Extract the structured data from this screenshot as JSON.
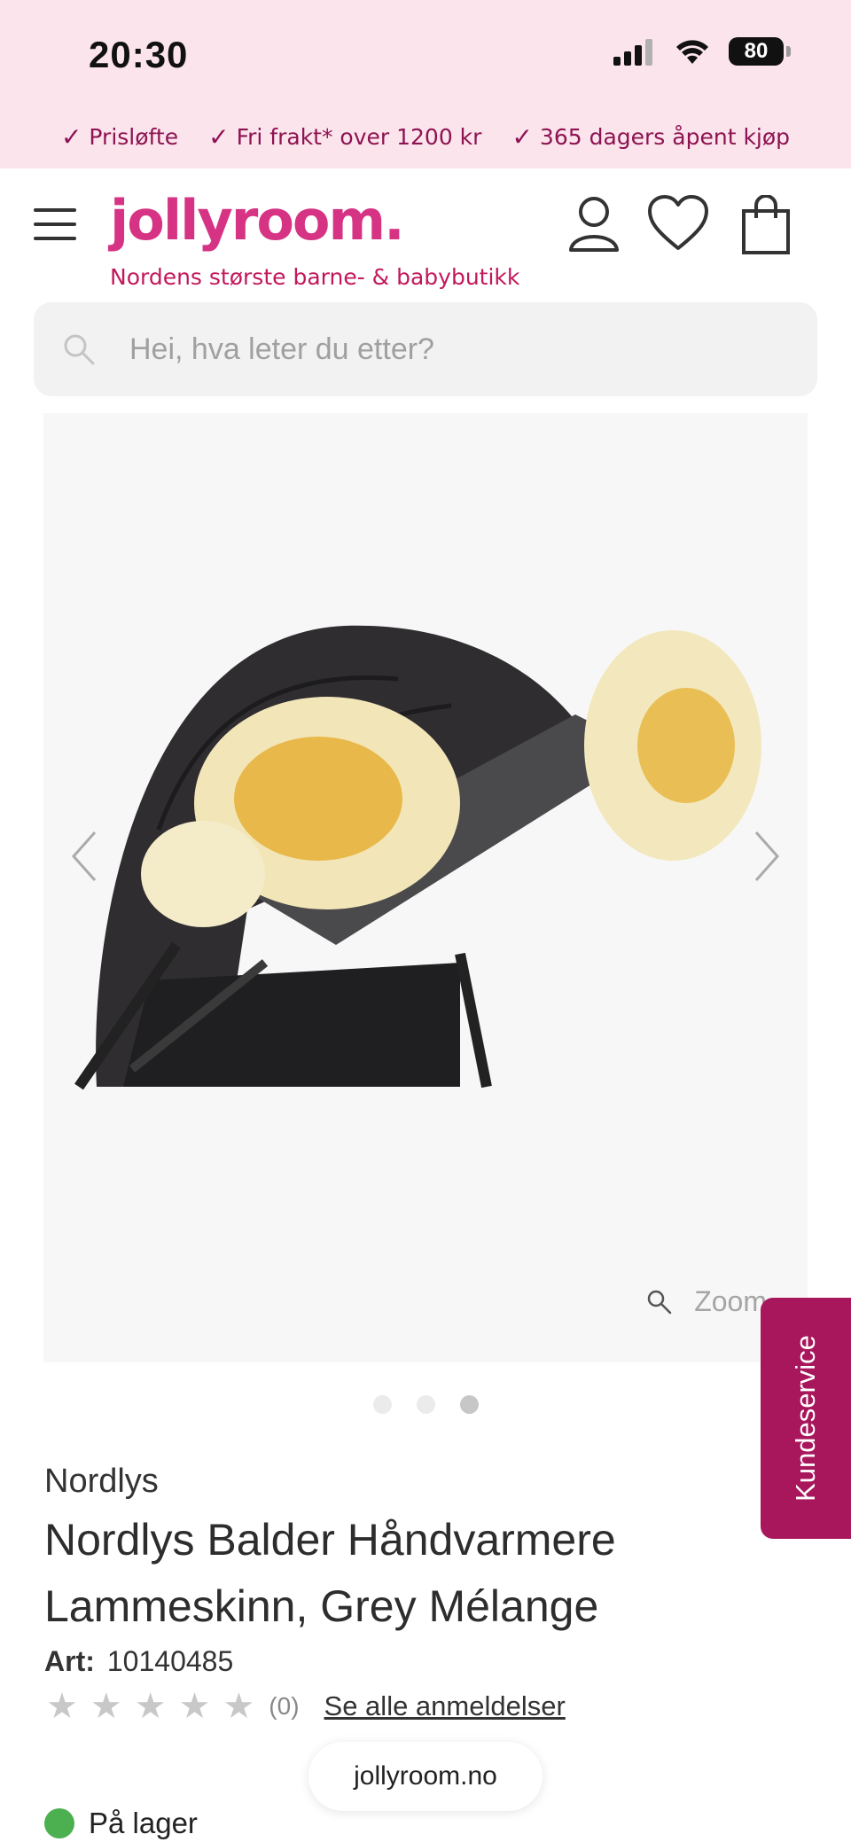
{
  "status_bar": {
    "time": "20:30",
    "battery": "80"
  },
  "promo": {
    "items": [
      "Prisløfte",
      "Fri frakt* over 1200 kr",
      "365 dagers åpent kjøp"
    ]
  },
  "header": {
    "logo": "jollyroom.",
    "tagline": "Nordens største barne- & babybutikk"
  },
  "search": {
    "placeholder": "Hei, hva leter du etter?"
  },
  "gallery": {
    "zoom_label": "Zoom",
    "dots_count": 3,
    "active_dot": 3
  },
  "kundeservice": {
    "label": "Kundeservice"
  },
  "product": {
    "brand": "Nordlys",
    "title": "Nordlys Balder Håndvarmere Lammeskinn, Grey Mélange",
    "art_label": "Art:",
    "art_number": "10140485",
    "rating_count": "(0)",
    "reviews_link": "Se alle anmeldelser",
    "stock": "På lager"
  },
  "domain": "jollyroom.no",
  "colors": {
    "brand_pink": "#d63384",
    "promo_bg": "#fce4ec",
    "accent_magenta": "#a8175c",
    "in_stock": "#4caf50"
  }
}
